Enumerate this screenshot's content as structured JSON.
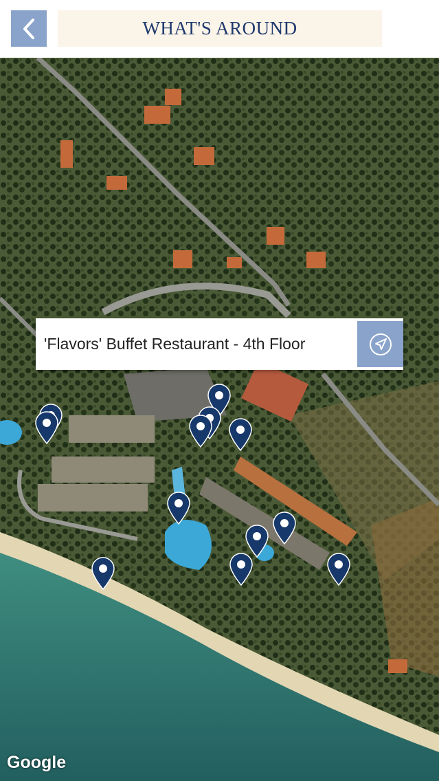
{
  "header": {
    "title": "WHAT'S AROUND",
    "back_icon": "chevron-left-icon"
  },
  "map": {
    "attribution": "Google",
    "map_type": "satellite",
    "selected_place": {
      "name": "'Flavors' Buffet Restaurant - 4th Floor",
      "nav_icon": "navigation-arrow-icon"
    },
    "pin_count": 14,
    "pin_icon": "map-pin-icon"
  },
  "colors": {
    "accent": "#8aa3cb",
    "title_text": "#1f3a6e",
    "title_bg": "#fbf4e8",
    "pin": "#17386b"
  }
}
